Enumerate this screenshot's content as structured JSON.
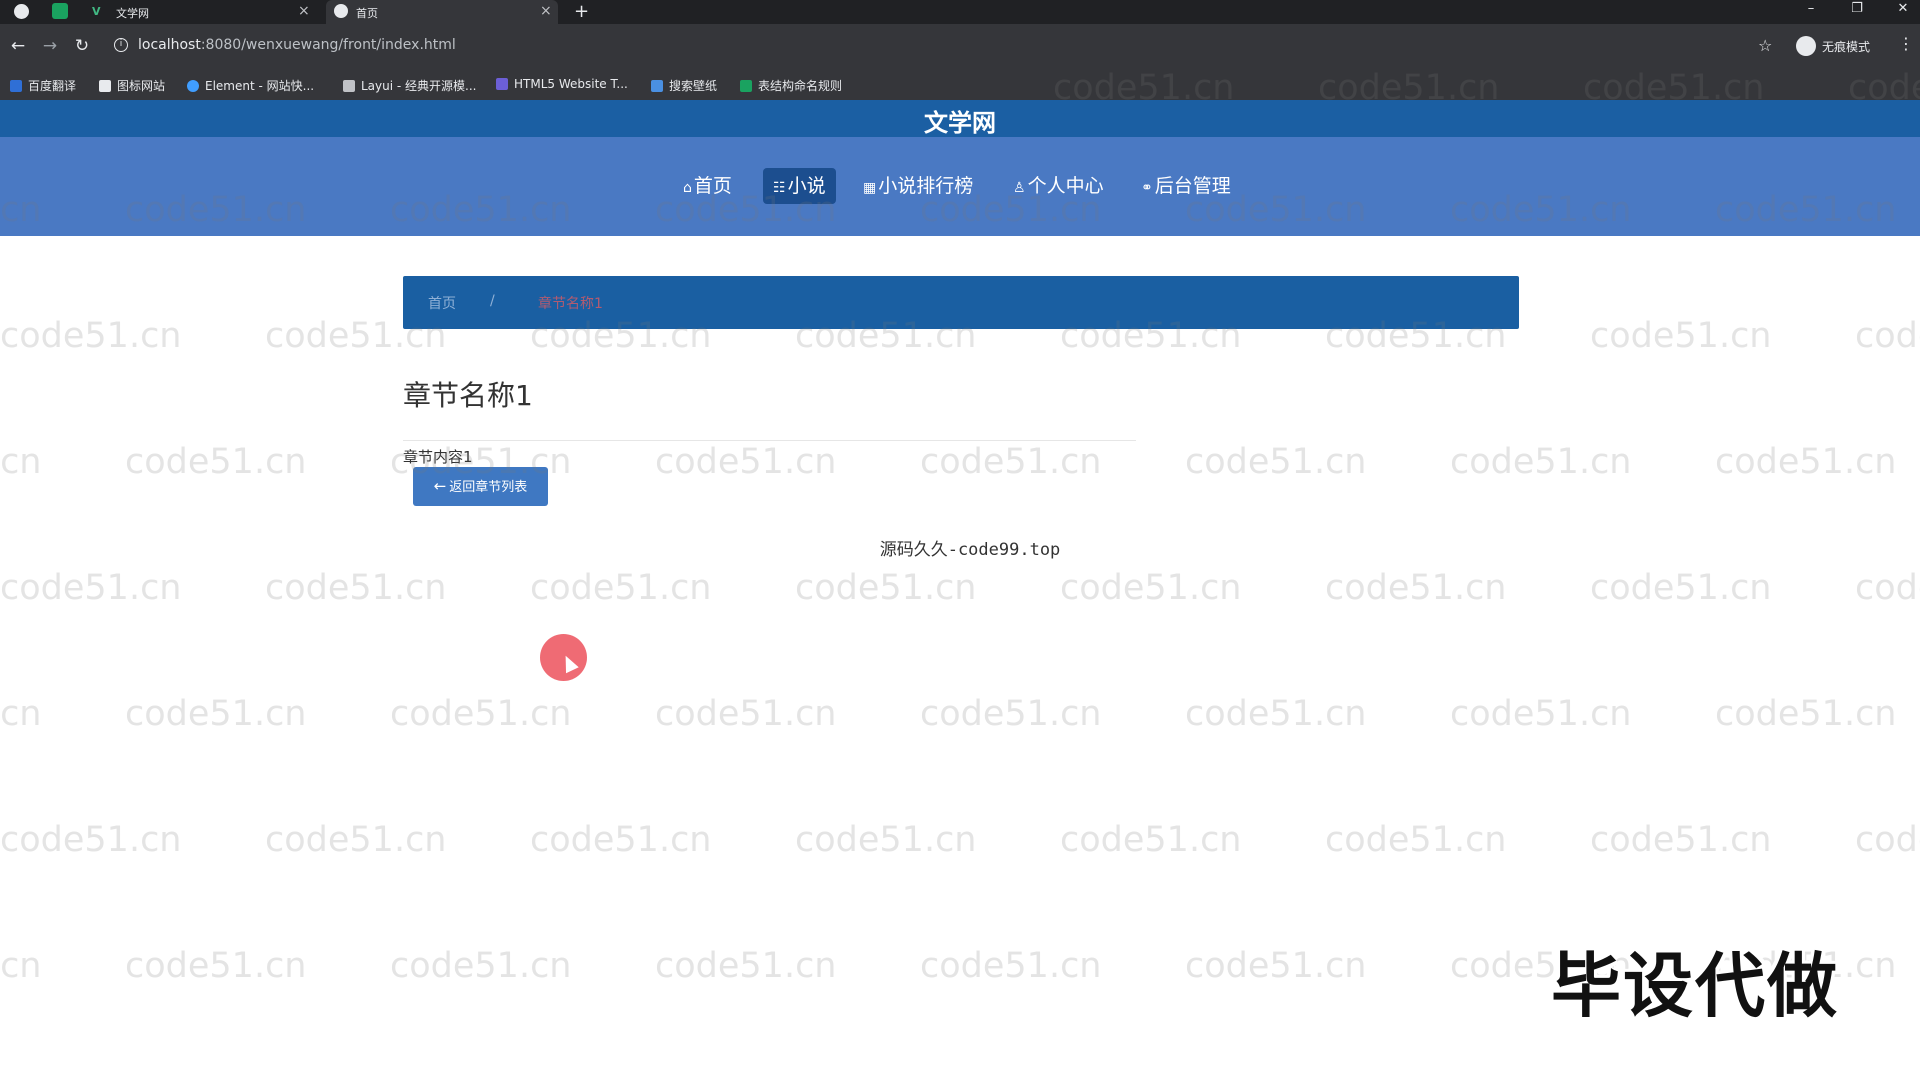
{
  "browser": {
    "tabs": [
      {
        "label": "文学网",
        "close": "×"
      },
      {
        "label": "首页",
        "close": "×"
      }
    ],
    "new_tab": "+",
    "window_controls": [
      "–",
      "❐",
      "✕"
    ],
    "nav": {
      "back": "←",
      "forward": "→",
      "reload": "↻"
    },
    "url_host": "localhost",
    "url_rest": ":8080/wenxuewang/front/index.html",
    "bookmark_star": "☆",
    "incognito_label": "无痕模式",
    "menu": "⋮",
    "bookmarks": [
      {
        "label": "百度翻译",
        "color": "#2f6fd6"
      },
      {
        "label": "图标网站",
        "color": "#e8eaed"
      },
      {
        "label": "Element - 网站快...",
        "color": "#409eff"
      },
      {
        "label": "Layui - 经典开源模...",
        "color": "#c0c2c6"
      },
      {
        "label": "HTML5 Website T...",
        "color": "#6c5fd6"
      },
      {
        "label": "搜索壁纸",
        "color": "#4a90e2"
      },
      {
        "label": "表结构命名规则",
        "color": "#1aa260"
      }
    ]
  },
  "site": {
    "title": "文学网",
    "nav": [
      {
        "icon": "⌂",
        "label": "首页",
        "active": false
      },
      {
        "icon": "☷",
        "label": "小说",
        "active": true
      },
      {
        "icon": "▦",
        "label": "小说排行榜",
        "active": false
      },
      {
        "icon": "♙",
        "label": "个人中心",
        "active": false
      },
      {
        "icon": "⚭",
        "label": "后台管理",
        "active": false
      }
    ],
    "colors": {
      "header_dark": "#1b5fa3",
      "header_nav": "#4a79c3",
      "accent": "#3f78c2"
    }
  },
  "breadcrumb": {
    "home": "首页",
    "separator": "/",
    "current": "章节名称1"
  },
  "chapter": {
    "title": "章节名称1",
    "content": "章节内容1",
    "back_label": "返回章节列表",
    "back_icon": "←"
  },
  "footer": {
    "text": "源码久久-code99.top"
  },
  "overlay": {
    "promo": "毕设代做",
    "watermark": "code51.cn"
  }
}
